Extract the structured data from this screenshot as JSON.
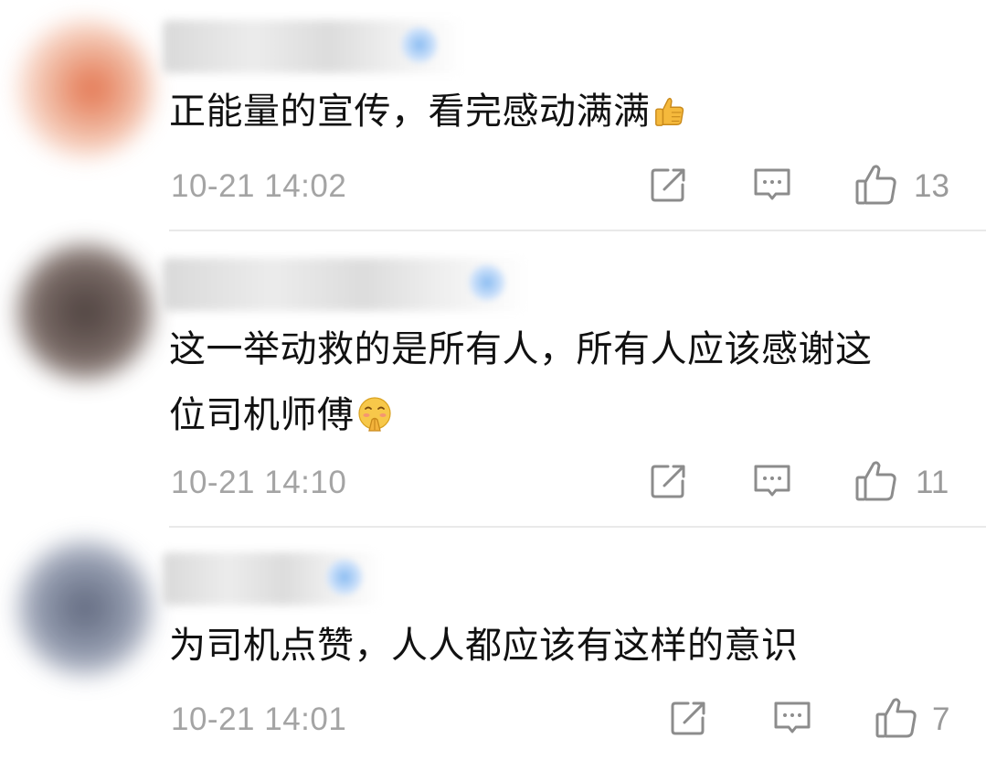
{
  "comments": [
    {
      "text": "正能量的宣传，看完感动满满",
      "emoji_icon": "thumbs-up-emoji",
      "time": "10-21 14:02",
      "likes": "13"
    },
    {
      "text_line1": "这一举动救的是所有人，所有人应该感谢这",
      "text_line2": "位司机师傅",
      "emoji_icon": "grateful-face-emoji",
      "time": "10-21 14:10",
      "likes": "11"
    },
    {
      "text": "为司机点赞，人人都应该有这样的意识",
      "time": "10-21 14:01",
      "likes": "7"
    }
  ],
  "icons": {
    "share": "share-icon",
    "reply": "comment-icon",
    "like": "thumbs-up-icon"
  },
  "colors": {
    "text": "#111111",
    "meta": "#a4a4a4",
    "icon": "#8c8c8c",
    "divider": "#e9e9e9"
  }
}
